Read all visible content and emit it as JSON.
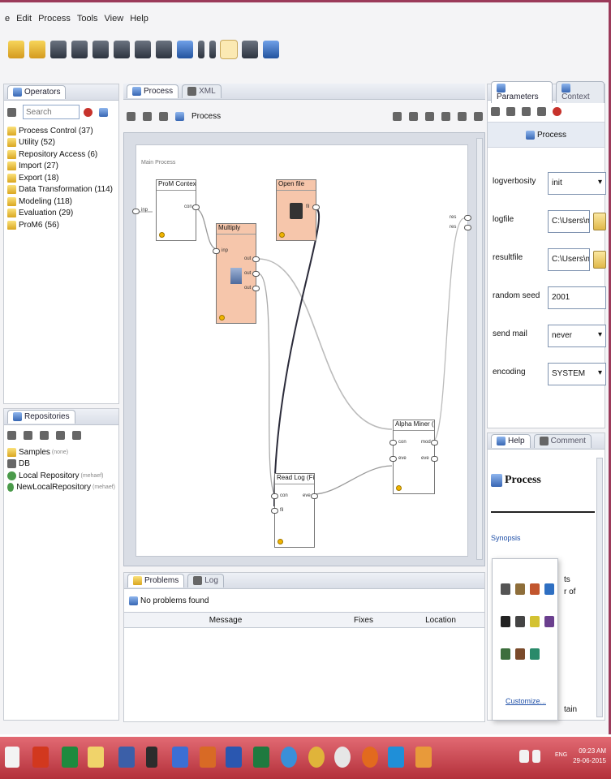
{
  "menu": [
    "e",
    "Edit",
    "Process",
    "Tools",
    "View",
    "Help"
  ],
  "operators_panel": {
    "tab_label": "Operators",
    "search_placeholder": "Search",
    "items": [
      "Process Control (37)",
      "Utility (52)",
      "Repository Access (6)",
      "Import (27)",
      "Export (18)",
      "Data Transformation (114)",
      "Modeling (118)",
      "Evaluation (29)",
      "ProM6 (56)"
    ]
  },
  "repositories_panel": {
    "tab_label": "Repositories",
    "items": [
      {
        "label": "Samples",
        "suffix": "(none)"
      },
      {
        "label": "DB",
        "suffix": ""
      },
      {
        "label": "Local Repository",
        "suffix": "(mehaef)"
      },
      {
        "label": "NewLocalRepository",
        "suffix": "(mehaef)"
      }
    ]
  },
  "process_tabs": {
    "process": "Process",
    "xml": "XML"
  },
  "breadcrumb": "Process",
  "canvas": {
    "label": "Main Process",
    "nodes": {
      "prom": {
        "title": "ProM Context",
        "port_out": "con"
      },
      "open": {
        "title": "Open file",
        "port_out": "fil"
      },
      "multiply": {
        "title": "Multiply",
        "port_in": "inp",
        "ports_out": [
          "out",
          "out",
          "out"
        ]
      },
      "readlog": {
        "title": "Read Log (File)",
        "port_in_1": "con",
        "port_in_2": "fil",
        "port_out": "eve"
      },
      "alpha": {
        "title": "Alpha Miner (...",
        "ports_in": [
          "con",
          "eve"
        ],
        "ports_out": [
          "mod",
          "eve"
        ]
      }
    },
    "left_port": "inp",
    "right_ports": [
      "res",
      "res"
    ]
  },
  "parameters_panel": {
    "tabs": [
      "Parameters",
      "Context"
    ],
    "header": "Process",
    "rows": [
      {
        "label": "logverbosity",
        "value": "init"
      },
      {
        "label": "logfile",
        "value": "C:\\Users\\mehaef"
      },
      {
        "label": "resultfile",
        "value": "C:\\Users\\mehaef"
      },
      {
        "label": "random seed",
        "value": "2001"
      },
      {
        "label": "send mail",
        "value": "never"
      },
      {
        "label": "encoding",
        "value": "SYSTEM"
      }
    ]
  },
  "help_panel": {
    "tabs": [
      "Help",
      "Comment"
    ],
    "title": "Process",
    "synopsis": "Synopsis",
    "fragments": [
      "ts",
      "r of",
      "tain"
    ]
  },
  "customize_popup": {
    "label": "Customize..."
  },
  "problems_panel": {
    "tabs": [
      "Problems",
      "Log"
    ],
    "status": "No problems found",
    "columns": [
      "Message",
      "Fixes",
      "Location"
    ]
  },
  "clock": {
    "time": "09:23 AM",
    "date": "29-06-2015",
    "lang": "ENG"
  }
}
